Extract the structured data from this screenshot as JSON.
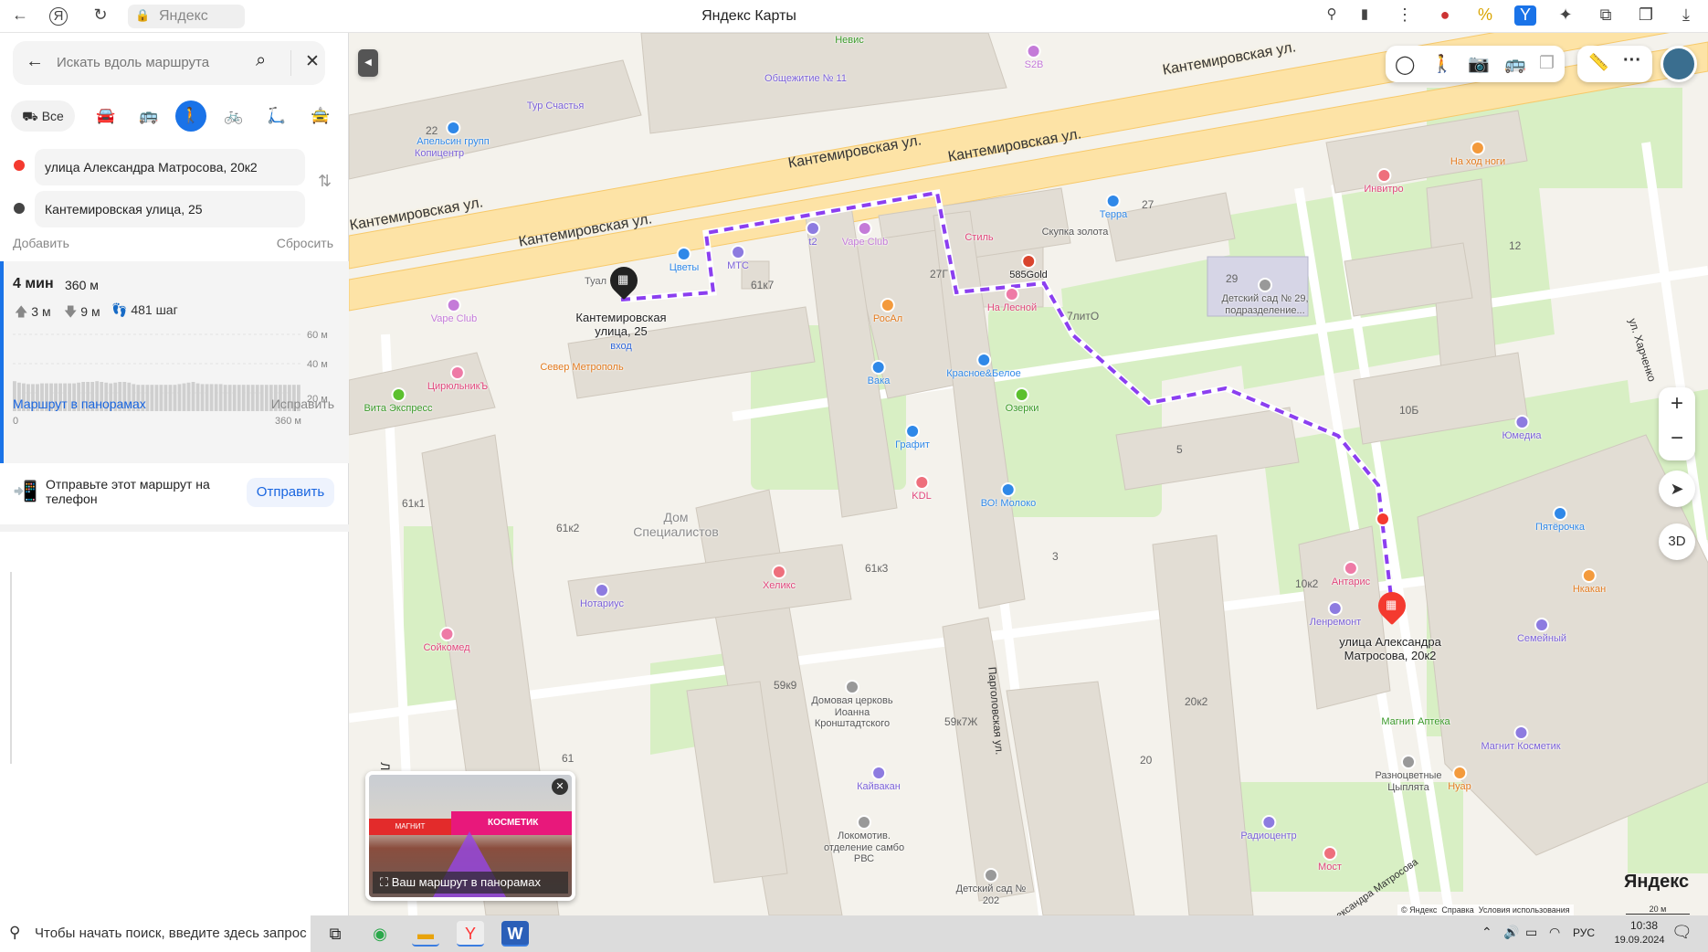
{
  "browser": {
    "site": "Яндекс",
    "title": "Яндекс Карты"
  },
  "panel": {
    "search_placeholder": "Искать вдоль маршрута",
    "modes": [
      {
        "label": "Все",
        "icon": "all-transport-icon"
      },
      {
        "icon": "car-icon"
      },
      {
        "icon": "bus-icon"
      },
      {
        "icon": "pedestrian-icon",
        "active": true
      },
      {
        "icon": "bicycle-icon"
      },
      {
        "icon": "scooter-icon"
      },
      {
        "icon": "taxi-icon"
      }
    ],
    "from": "улица Александра Матросова, 20к2",
    "to": "Кантемировская улица, 25",
    "add": "Добавить",
    "reset": "Сбросить",
    "route": {
      "time": "4 мин",
      "distance": "360 м",
      "ascent": "3 м",
      "descent": "9 м",
      "steps": "481 шаг",
      "elevation": {
        "y_ticks": [
          "60 м",
          "40 м",
          "20 м"
        ],
        "x_start": "0",
        "x_end": "360 м",
        "ylim": [
          10,
          60
        ],
        "values": [
          28,
          27,
          26.5,
          26,
          26,
          26,
          26.5,
          26.5,
          26.5,
          26.5,
          26.5,
          26.5,
          26.5,
          26.5,
          27,
          27.5,
          27.5,
          27.5,
          28,
          27.5,
          27,
          26.5,
          27,
          27.5,
          27.5,
          27,
          26,
          25.5,
          25.5,
          25.5,
          25.5,
          25.5,
          25.5,
          25.5,
          25.5,
          25.5,
          26,
          26.5,
          27,
          27.5,
          26.5,
          26,
          26,
          26,
          26,
          26,
          25.5,
          25.5,
          25.5,
          25.5,
          25.5,
          25.5,
          25.5,
          25.5,
          25.5,
          25.5,
          25.5,
          25.5,
          25.5,
          25.5,
          25.5,
          25.5,
          25.5
        ]
      }
    },
    "panorama_link": "Маршрут в панорамах",
    "fix": "Исправить",
    "send_text": "Отправьте этот маршрут на телефон",
    "send_button": "Отправить"
  },
  "map": {
    "streets": [
      "Кантемировская ул.",
      "Кантемировская ул.",
      "Кантемировская ул.",
      "Кантемировская ул.",
      "Кантемировская ул.",
      "ул. Харченко",
      "Парголовская ул.",
      "Лесно",
      "Александра Матросова"
    ],
    "pois": [
      "Невис",
      "Общежитие № 11",
      "Тур Счастья",
      "Апельсин групп",
      "Копицентр",
      "Цветы",
      "МТС",
      "t2",
      "Vape Club",
      "Стиль",
      "Скупка золота",
      "Терра",
      "585Gold",
      "На Лесной",
      "Детский сад № 29, подразделение...",
      "На ход ноги",
      "Инвитро",
      "Юмедиа",
      "Vape Club",
      "ЦирюльникЪ",
      "Север Метрополь",
      "Вита Экспресс",
      "РосАл",
      "Вака",
      "Красное&Белое",
      "Озерки",
      "Графит",
      "KDL",
      "ВО! Молоко",
      "Дом Специалистов",
      "Нотариус",
      "Хеликс",
      "Сойкомед",
      "Домовая церковь Иоанна Кронштадтского",
      "Кайвакан",
      "Локомотив. отделение самбо РВС",
      "Детский сад № 202",
      "Пятёрочка",
      "Нкакан",
      "Семейный",
      "Антарис",
      "Ленремонт",
      "Магнит Аптека",
      "Магнит Косметик",
      "Разноцветные Цыплята",
      "Нуар",
      "Радиоцентр",
      "Мост",
      "S2B",
      "Туал"
    ],
    "houses": [
      "22",
      "27",
      "29",
      "12",
      "10Б",
      "5",
      "61к1",
      "61к2",
      "61к3",
      "61к7",
      "27Г",
      "3",
      "59к9",
      "59к7Ж",
      "20к2",
      "20",
      "10к2",
      "7литО",
      "61"
    ],
    "start_label": "Кантемировская улица, 25",
    "start_sub": "вход",
    "end_label": "улица Александра Матросова, 20к2",
    "panorama_caption": "Ваш маршрут в панорамах",
    "panorama_signs": [
      "КОСМЕТИК",
      "МАГНИТ"
    ],
    "control_3d": "3D",
    "logo": "Яндекс",
    "footer": [
      "© Яндекс",
      "Справка",
      "Условия использования"
    ],
    "scale": "20 м",
    "route_color": "#8b3ff0"
  },
  "taskbar": {
    "search_placeholder": "Чтобы начать поиск, введите здесь запрос",
    "lang": "РУС",
    "time": "10:38",
    "date": "19.09.2024"
  }
}
